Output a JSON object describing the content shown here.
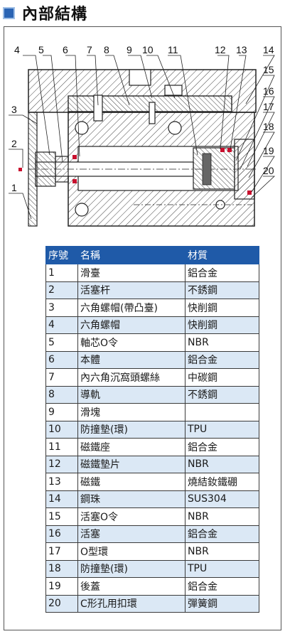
{
  "header": {
    "title": "內部結構",
    "accent_color": "#2a64b4",
    "icon": "square-bullet-icon"
  },
  "drawing": {
    "callouts": [
      "1",
      "2",
      "3",
      "4",
      "5",
      "6",
      "7",
      "8",
      "9",
      "10",
      "11",
      "12",
      "13",
      "14",
      "15",
      "16",
      "17",
      "18",
      "19",
      "20"
    ]
  },
  "table": {
    "columns": [
      "序號",
      "名稱",
      "材質"
    ],
    "header_color": "#1f5aa8",
    "stripe_color": "#dbe8f5",
    "rows": [
      {
        "no": "1",
        "name": "滑臺",
        "material": "鋁合金"
      },
      {
        "no": "2",
        "name": "活塞杆",
        "material": "不銹鋼"
      },
      {
        "no": "3",
        "name": "六角螺帽(帶凸臺)",
        "material": "快削鋼"
      },
      {
        "no": "4",
        "name": "六角螺帽",
        "material": "快削鋼"
      },
      {
        "no": "5",
        "name": "軸芯O令",
        "material": "NBR"
      },
      {
        "no": "6",
        "name": "本體",
        "material": "鋁合金"
      },
      {
        "no": "7",
        "name": "內六角沉窩頭螺絲",
        "material": "中碳鋼"
      },
      {
        "no": "8",
        "name": "導軌",
        "material": "不銹鋼"
      },
      {
        "no": "9",
        "name": "滑塊",
        "material": ""
      },
      {
        "no": "10",
        "name": "防撞墊(環)",
        "material": "TPU"
      },
      {
        "no": "11",
        "name": "磁鐵座",
        "material": "鋁合金"
      },
      {
        "no": "12",
        "name": "磁鐵墊片",
        "material": "NBR"
      },
      {
        "no": "13",
        "name": "磁鐵",
        "material": "燒結釹鐵硼"
      },
      {
        "no": "14",
        "name": "鋼珠",
        "material": "SUS304"
      },
      {
        "no": "15",
        "name": "活塞O令",
        "material": "NBR"
      },
      {
        "no": "16",
        "name": "活塞",
        "material": "鋁合金"
      },
      {
        "no": "17",
        "name": "O型環",
        "material": "NBR"
      },
      {
        "no": "18",
        "name": "防撞墊(環)",
        "material": "TPU"
      },
      {
        "no": "19",
        "name": "後蓋",
        "material": "鋁合金"
      },
      {
        "no": "20",
        "name": "C形孔用扣環",
        "material": "彈簧鋼"
      }
    ]
  }
}
